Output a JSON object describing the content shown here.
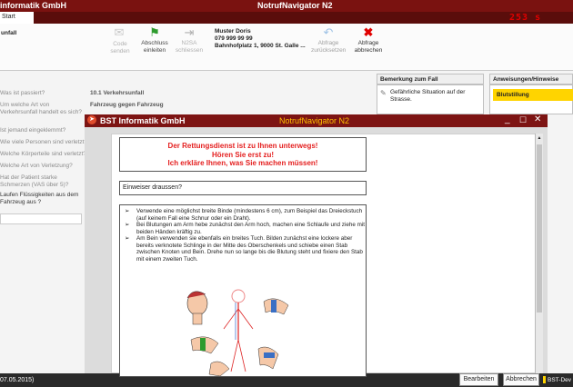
{
  "app": {
    "title_left": "informatik GmbH",
    "title_center": "NotrufNavigator N2"
  },
  "tabs": {
    "start": "Start"
  },
  "timer": "253 s",
  "ribbon": {
    "group_label": "unfall",
    "code_senden": "Code senden",
    "abschluss": "Abschluss\neinleiten",
    "n2sa": "N2SA\nschliessen",
    "caller_name": "Muster Doris",
    "caller_phone": "079 999 99 99",
    "caller_address": "Bahnhofplatz 1, 9000 St. Galle ...",
    "abfrage_zurueck": "Abfrage\nzurücksetzen",
    "abfrage_abbrechen": "Abfrage\nabbrechen"
  },
  "panels": {
    "bemerkung": "Bemerkung zum Fall",
    "anweisungen": "Anweisungen/Hinweise"
  },
  "bemerkung_text": "Gefährliche Situation auf der Strasse.",
  "anweisung_item": "Blutstillung",
  "questions": [
    {
      "q": "Was ist passiert?",
      "a": "10.1 Verkehrsunfall"
    },
    {
      "q": "Um welche Art von Verkehrsunfall handelt es sich?",
      "a": "Fahrzeug gegen Fahrzeug"
    },
    {
      "q": "Ist jemand eingeklemmt?",
      "a": ""
    },
    {
      "q": "Wie viele Personen sind verletzt?",
      "a": ""
    },
    {
      "q": "Welche Körperteile sind verletzt?",
      "a": ""
    },
    {
      "q": "Welche Art von Verletzung?",
      "a": ""
    },
    {
      "q": "Hat der Patient starke Schmerzen (VAS über 5)?",
      "a": ""
    },
    {
      "q": "Laufen Flüssigkeiten aus dem Fahrzeug aus ?",
      "a": ""
    }
  ],
  "status_left": "07.05.2015)",
  "modal": {
    "app_name": "BST Informatik GmbH",
    "title_center": "NotrufNavigator N2",
    "red_line1": "Der Rettungsdienst ist zu Ihnen unterwegs!",
    "red_line2": "Hören Sie erst zu!",
    "red_line3": "Ich erkläre Ihnen, was Sie machen müssen!",
    "einweiser": "Einweiser draussen?",
    "instructions": [
      "Verwende eine möglichst breite Binde (mindestens 6 cm), zum Beispiel das Dreieckstuch (auf keinem Fall eine Schnur oder ein Draht).",
      "Bei Blutungen am Arm hebe zunächst den Arm hoch, machen eine Schlaufe und ziehe mit beiden Händen kräftig zu.",
      "Am Bein verwenden sie ebenfalls ein breites Tuch. Bilden zunächst eine lockere aber bereits verknotete Schlinge in der Mitte des Oberschenkels und schiebe einen Stab zwischen Knoten und Bein. Drehe nun so lange bis die Blutung steht und fixiere den Stab mit einem zweiten Tuch."
    ],
    "bearbeiten": "Bearbeiten",
    "abbrechen": "Abbrechen",
    "taskbar_item": "BST-Dev"
  },
  "colors": {
    "brand_dark_red": "#7d1413",
    "alert_red": "#e41e1e",
    "anweisung_yellow": "#ffd400",
    "ok_green": "#2e9b2e"
  }
}
